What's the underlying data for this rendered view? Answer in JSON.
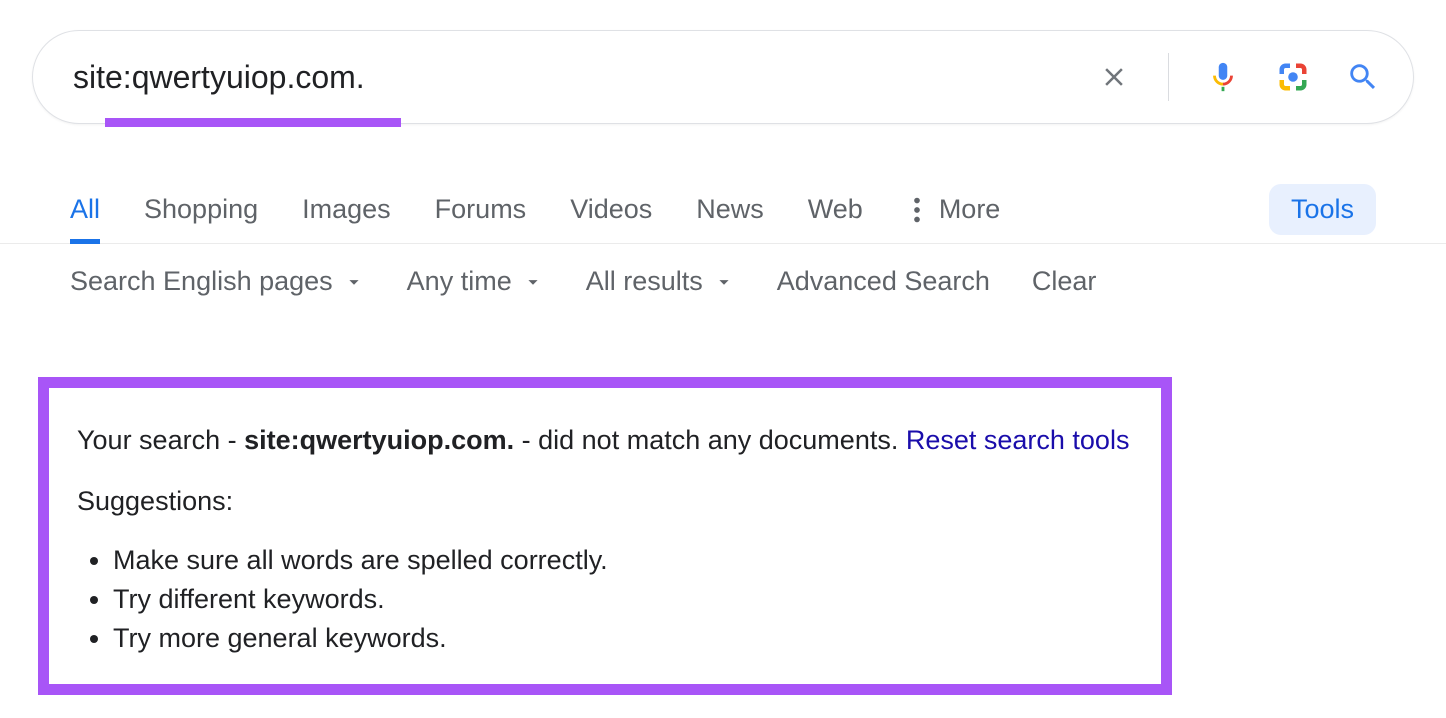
{
  "search": {
    "query": "site:qwertyuiop.com.",
    "clear_label": "Clear",
    "mic_label": "Search by voice",
    "lens_label": "Search by image",
    "submit_label": "Search"
  },
  "tabs": {
    "items": [
      "All",
      "Shopping",
      "Images",
      "Forums",
      "Videos",
      "News",
      "Web"
    ],
    "more": "More",
    "tools": "Tools",
    "active_index": 0
  },
  "filters": {
    "language": "Search English pages",
    "time": "Any time",
    "results": "All results",
    "advanced": "Advanced Search",
    "clear": "Clear"
  },
  "no_results": {
    "prefix": "Your search - ",
    "query_echo": "site:qwertyuiop.com.",
    "suffix": " - did not match any documents. ",
    "reset": "Reset search tools",
    "suggestions_heading": "Suggestions:",
    "suggestions": [
      "Make sure all words are spelled correctly.",
      "Try different keywords.",
      "Try more general keywords."
    ]
  }
}
